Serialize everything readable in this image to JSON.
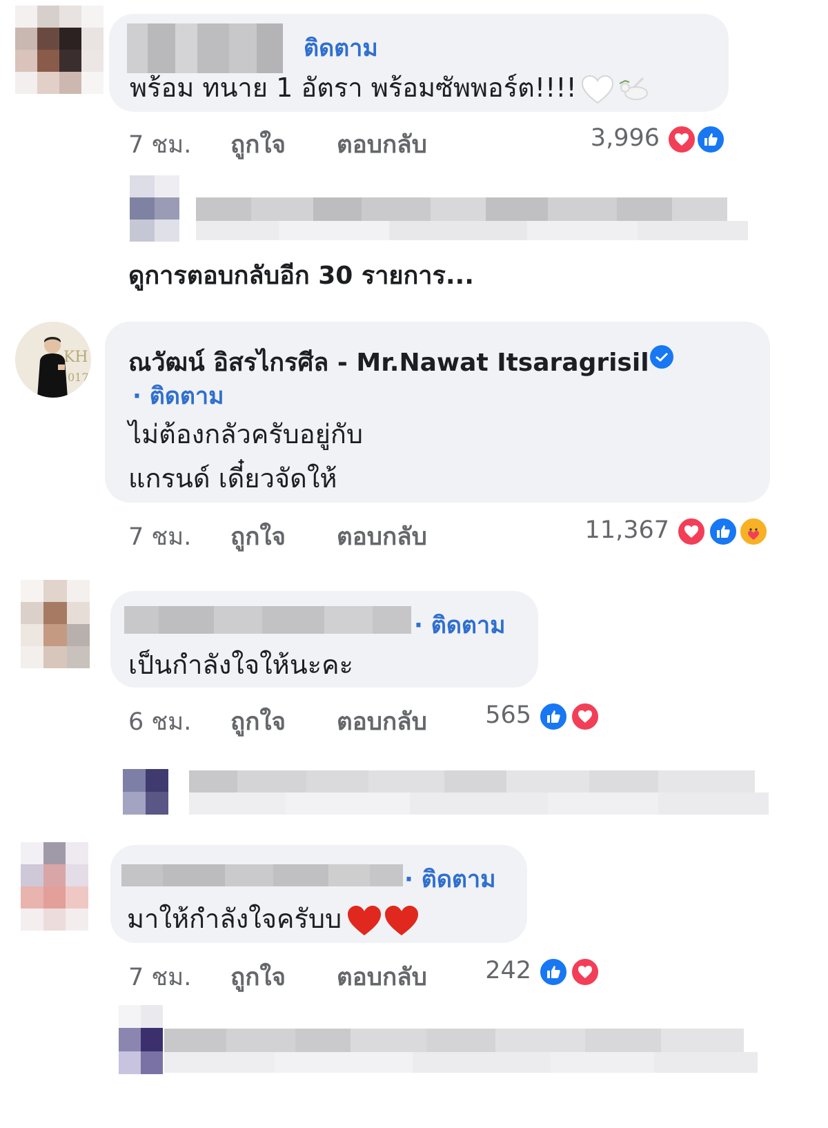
{
  "comments": [
    {
      "follow": "ติดตาม",
      "text": "พร้อม ทนาย 1 อัตรา พร้อมซัพพอร์ต!!!!",
      "time": "7 ชม.",
      "like": "ถูกใจ",
      "reply": "ตอบกลับ",
      "reaction_count": "3,996",
      "reactions": [
        "heart-icon",
        "like-icon"
      ]
    },
    {
      "author": "ณวัฒน์ อิสรไกรศีล - Mr.Nawat Itsaragrisil",
      "follow": "· ติดตาม",
      "text_line1": "ไม่ต้องกลัวครับอยู่กับ",
      "text_line2": "แกรนด์ เดี๋ยวจัดให้",
      "time": "7 ชม.",
      "like": "ถูกใจ",
      "reply": "ตอบกลับ",
      "reaction_count": "11,367",
      "reactions": [
        "heart-icon",
        "like-icon",
        "care-icon"
      ]
    },
    {
      "follow": "· ติดตาม",
      "text": "เป็นกำลังใจให้นะคะ",
      "time": "6 ชม.",
      "like": "ถูกใจ",
      "reply": "ตอบกลับ",
      "reaction_count": "565",
      "reactions": [
        "like-icon",
        "heart-icon"
      ]
    },
    {
      "follow": "· ติดตาม",
      "text": "มาให้กำลังใจครับบ",
      "time": "7 ชม.",
      "like": "ถูกใจ",
      "reply": "ตอบกลับ",
      "reaction_count": "242",
      "reactions": [
        "like-icon",
        "heart-icon"
      ]
    }
  ],
  "view_more_replies": "ดูการตอบกลับอีก 30 รายการ...",
  "colors": {
    "bubble": "#f0f2f5",
    "follow": "#2f6fcf",
    "love": "#f33e58",
    "like": "#1877f2",
    "muted": "#65676b"
  }
}
